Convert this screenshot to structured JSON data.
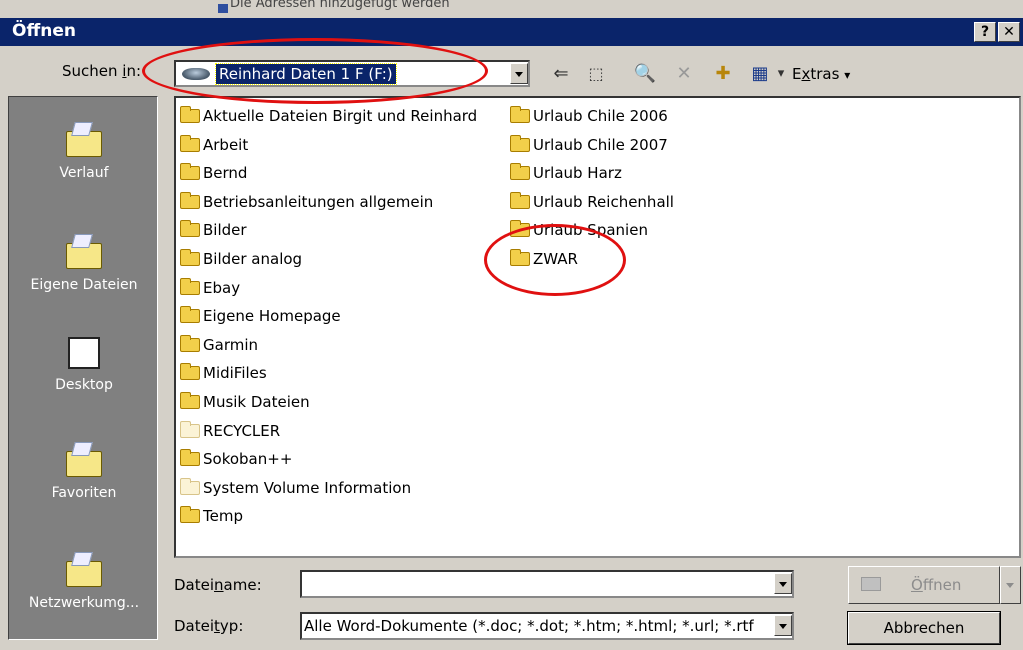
{
  "background_window": {
    "text": "Die Adressen hinzugefügt werden"
  },
  "dialog": {
    "title": "Öffnen",
    "help_button": "?",
    "close_button": "✕"
  },
  "look_in": {
    "label_pre": "Suchen ",
    "label_accel": "i",
    "label_post": "n:",
    "value": "Reinhard Daten 1 F (F:)"
  },
  "toolbar": {
    "back_glyph": "⇐",
    "up_glyph": "⬚",
    "search_web_glyph": "🔍",
    "delete_glyph": "✕",
    "new_folder_glyph": "✚",
    "views_glyph": "▦",
    "views_arrow": "▾",
    "tools_pre": "E",
    "tools_accel": "x",
    "tools_post": "tras",
    "tools_arrow": "▾"
  },
  "places": [
    {
      "name": "place-history",
      "label": "Verlauf"
    },
    {
      "name": "place-my-documents",
      "label": "Eigene Dateien"
    },
    {
      "name": "place-desktop",
      "label": "Desktop"
    },
    {
      "name": "place-favorites",
      "label": "Favoriten"
    },
    {
      "name": "place-network",
      "label": "Netzwerkumg..."
    }
  ],
  "files_col1": [
    {
      "label": "Aktuelle Dateien Birgit und Reinhard",
      "hidden": false
    },
    {
      "label": "Arbeit",
      "hidden": false
    },
    {
      "label": "Bernd",
      "hidden": false
    },
    {
      "label": "Betriebsanleitungen allgemein",
      "hidden": false
    },
    {
      "label": "Bilder",
      "hidden": false
    },
    {
      "label": "Bilder analog",
      "hidden": false
    },
    {
      "label": "Ebay",
      "hidden": false
    },
    {
      "label": "Eigene Homepage",
      "hidden": false
    },
    {
      "label": "Garmin",
      "hidden": false
    },
    {
      "label": "MidiFiles",
      "hidden": false
    },
    {
      "label": "Musik Dateien",
      "hidden": false
    },
    {
      "label": "RECYCLER",
      "hidden": true
    },
    {
      "label": "Sokoban++",
      "hidden": false
    },
    {
      "label": "System Volume Information",
      "hidden": true
    },
    {
      "label": "Temp",
      "hidden": false
    }
  ],
  "files_col2": [
    {
      "label": "Urlaub Chile 2006",
      "hidden": false
    },
    {
      "label": "Urlaub Chile 2007",
      "hidden": false
    },
    {
      "label": "Urlaub Harz",
      "hidden": false
    },
    {
      "label": "Urlaub Reichenhall",
      "hidden": false
    },
    {
      "label": "Urlaub Spanien",
      "hidden": false
    },
    {
      "label": "ZWAR",
      "hidden": false
    }
  ],
  "filename": {
    "label_pre": "Datei",
    "label_accel": "n",
    "label_post": "ame:",
    "value": ""
  },
  "filetype": {
    "label_pre": "Datei",
    "label_accel": "t",
    "label_post": "yp:",
    "value": "Alle Word-Dokumente (*.doc; *.dot; *.htm; *.html; *.url; *.rtf"
  },
  "buttons": {
    "open_pre": "",
    "open_accel": "Ö",
    "open_post": "ffnen",
    "cancel": "Abbrechen"
  },
  "colors": {
    "title_bar": "#0a246a",
    "window": "#d4d0c8",
    "places_bar": "#808080",
    "annotation": "#e01010"
  }
}
